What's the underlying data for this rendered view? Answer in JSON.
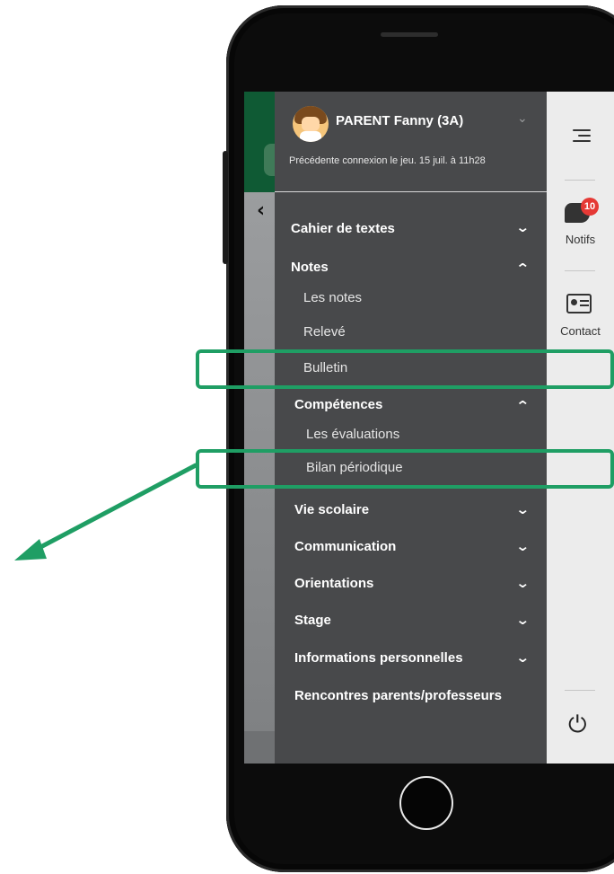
{
  "profile": {
    "name": "PARENT Fanny (3A)",
    "last_login": "Précédente connexion le jeu. 15 juil. à 11h28",
    "caret": "⌄"
  },
  "menu": {
    "cahier": "Cahier de textes",
    "notes": "Notes",
    "les_notes": "Les notes",
    "releve": "Relevé",
    "bulletin": "Bulletin",
    "competences": "Compétences",
    "les_evaluations": "Les évaluations",
    "bilan": "Bilan périodique",
    "vie_scolaire": "Vie scolaire",
    "communication": "Communication",
    "orientations": "Orientations",
    "stage": "Stage",
    "infos_perso": "Informations personnelles",
    "rencontres": "Rencontres parents/professeurs",
    "chevron_down": "⌄",
    "chevron_up": "⌃"
  },
  "rail": {
    "notifs_label": "Notifs",
    "notifs_count": "10",
    "contact_label": "Contact",
    "power_glyph": "⏻"
  },
  "background": {
    "back_glyph": "‹"
  },
  "colors": {
    "menu_bg": "#48494b",
    "rail_bg": "#ececec",
    "highlight": "#1f9e64",
    "badge": "#e53935"
  },
  "icons": [
    "menu-lines-icon",
    "butterfly-notif-icon",
    "contact-card-icon",
    "power-icon",
    "chevron-down-icon",
    "chevron-up-icon",
    "back-chevron-icon"
  ]
}
